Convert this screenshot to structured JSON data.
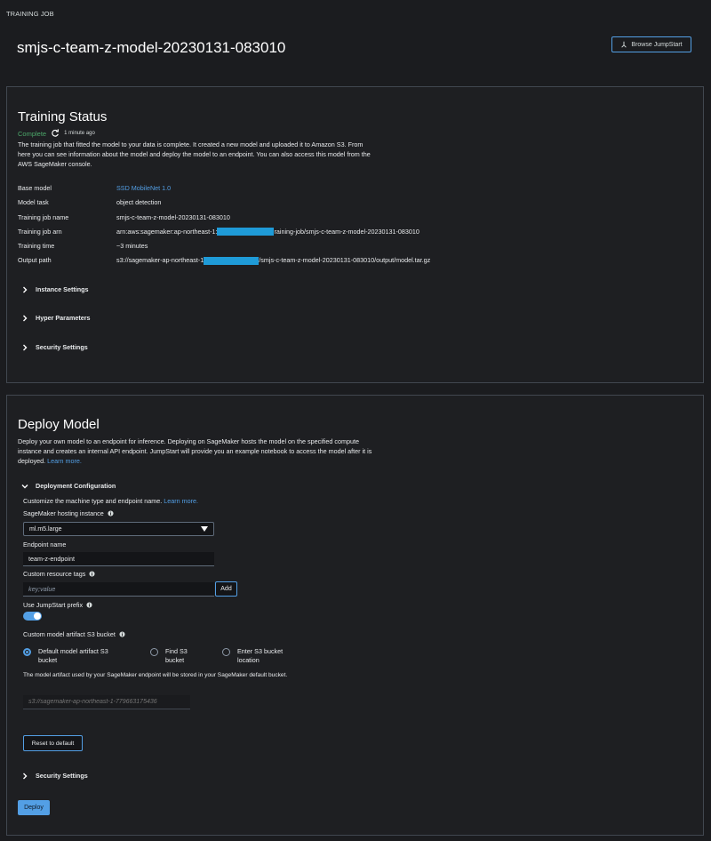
{
  "header": {
    "section_label": "TRAINING JOB",
    "title": "smjs-c-team-z-model-20230131-083010",
    "browse_button": "Browse JumpStart"
  },
  "training_status": {
    "title": "Training Status",
    "status": "Complete",
    "status_time": "1 minute ago",
    "description": "The training job that fitted the model to your data is complete. It created a new model and uploaded it to Amazon S3. From here you can see information about the model and deploy the model to an endpoint. You can also access this model from the AWS SageMaker console.",
    "details": [
      {
        "key": "Base model",
        "value": "SSD MobileNet 1.0"
      },
      {
        "key": "Model task",
        "value": "object detection"
      },
      {
        "key": "Training job name",
        "value": "smjs-c-team-z-model-20230131-083010"
      },
      {
        "key": "Training job arn",
        "value_prefix": "arn:aws:sagemaker:ap-northeast-1:",
        "value_suffix": "raining-job/smjs-c-team-z-model-20230131-083010"
      },
      {
        "key": "Training time",
        "value": "~3 minutes"
      },
      {
        "key": "Output path",
        "value_prefix": "s3://sagemaker-ap-northeast-1",
        "value_suffix": "/smjs-c-team-z-model-20230131-083010/output/model.tar.gz"
      }
    ],
    "expanders": [
      "Instance Settings",
      "Hyper Parameters",
      "Security Settings"
    ]
  },
  "deploy": {
    "title": "Deploy Model",
    "description": "Deploy your own model to an endpoint for inference. Deploying on SageMaker hosts the model on the specified compute instance and creates an internal API endpoint. JumpStart will provide you an example notebook to access the model after it is deployed.",
    "description_link": "Learn more.",
    "config_title": "Deployment Configuration",
    "config_desc": "Customize the machine type and endpoint name.",
    "config_link": "Learn more.",
    "hosting_label": "SageMaker hosting instance",
    "hosting_value": "ml.m5.large",
    "endpoint_label": "Endpoint name",
    "endpoint_value": "team-z-endpoint",
    "tags_label": "Custom resource tags",
    "tags_placeholder": "key;value",
    "add_button": "Add",
    "prefix_label": "Use JumpStart prefix",
    "prefix_enabled": true,
    "bucket_label": "Custom model artifact S3 bucket",
    "bucket_options": [
      {
        "label_1": "Default model artifact S3",
        "label_2": "bucket",
        "selected": true
      },
      {
        "label_1": "Find S3",
        "label_2": "bucket",
        "selected": false
      },
      {
        "label_1": "Enter S3 bucket",
        "label_2": "location",
        "selected": false
      }
    ],
    "bucket_note": "The model artifact used by your SageMaker endpoint will be stored in your SageMaker default bucket.",
    "bucket_placeholder": "s3://sagemaker-ap-northeast-1-779663175436",
    "reset_button": "Reset to default",
    "security_title": "Security Settings",
    "deploy_button": "Deploy"
  },
  "colors": {
    "accent": "#539fe5",
    "success": "#4ca86a",
    "background": "#1b1c1f"
  }
}
